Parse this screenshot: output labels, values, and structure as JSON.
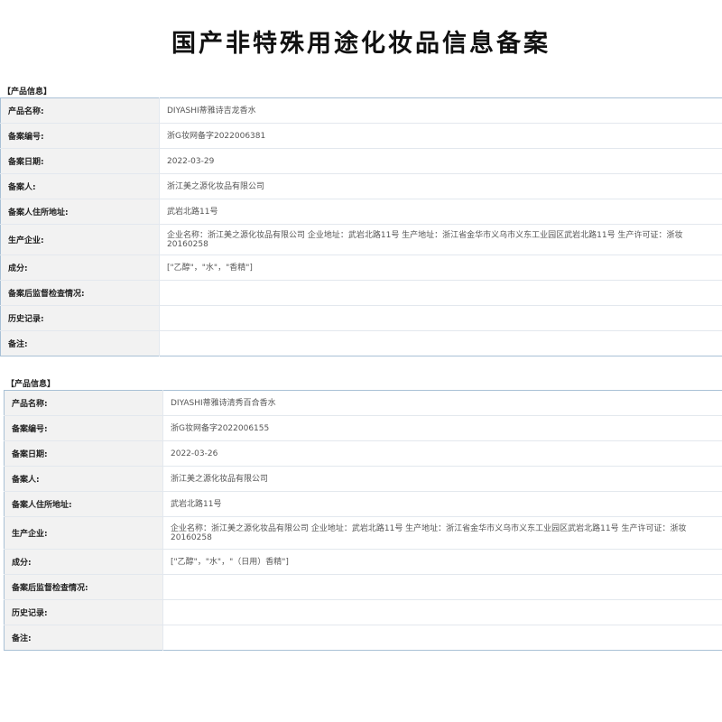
{
  "page_title": "国产非特殊用途化妆品信息备案",
  "records": [
    {
      "section_label": "【产品信息】",
      "rows": [
        {
          "label": "产品名称:",
          "value": "DIYASHI蒂雅诗吉龙香水"
        },
        {
          "label": "备案编号:",
          "value": "浙G妆网备字2022006381"
        },
        {
          "label": "备案日期:",
          "value": "2022-03-29"
        },
        {
          "label": "备案人:",
          "value": "浙江美之源化妆品有限公司"
        },
        {
          "label": "备案人住所地址:",
          "value": "武岩北路11号"
        },
        {
          "label": "生产企业:",
          "value": "企业名称：浙江美之源化妆品有限公司 企业地址：武岩北路11号 生产地址：浙江省金华市义乌市义东工业园区武岩北路11号 生产许可证：浙妆20160258"
        },
        {
          "label": "成分:",
          "value": "[\"乙醇\"，\"水\"，\"香精\"]"
        },
        {
          "label": "备案后监督检查情况:",
          "value": ""
        },
        {
          "label": "历史记录:",
          "value": ""
        },
        {
          "label": "备注:",
          "value": ""
        }
      ]
    },
    {
      "section_label": "【产品信息】",
      "rows": [
        {
          "label": "产品名称:",
          "value": "DIYASHI蒂雅诗清秀百合香水"
        },
        {
          "label": "备案编号:",
          "value": "浙G妆网备字2022006155"
        },
        {
          "label": "备案日期:",
          "value": "2022-03-26"
        },
        {
          "label": "备案人:",
          "value": "浙江美之源化妆品有限公司"
        },
        {
          "label": "备案人住所地址:",
          "value": "武岩北路11号"
        },
        {
          "label": "生产企业:",
          "value": "企业名称：浙江美之源化妆品有限公司 企业地址：武岩北路11号 生产地址：浙江省金华市义乌市义东工业园区武岩北路11号 生产许可证：浙妆20160258"
        },
        {
          "label": "成分:",
          "value": "[\"乙醇\"，\"水\"，\"（日用）香精\"]"
        },
        {
          "label": "备案后监督检查情况:",
          "value": ""
        },
        {
          "label": "历史记录:",
          "value": ""
        },
        {
          "label": "备注:",
          "value": ""
        }
      ]
    }
  ]
}
